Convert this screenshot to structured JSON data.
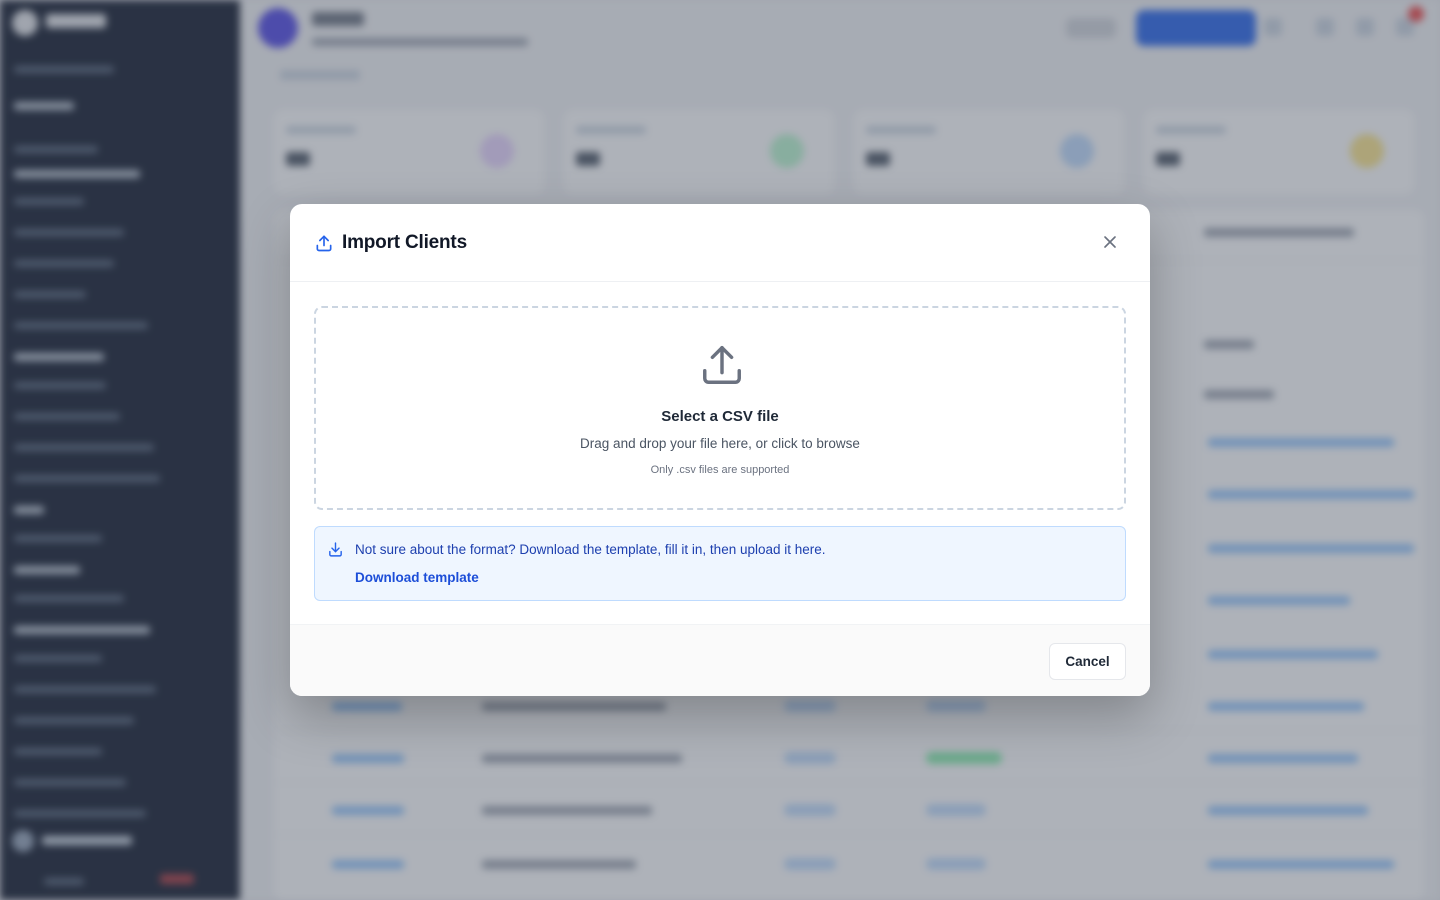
{
  "modal": {
    "title": "Import Clients",
    "close_icon": "close-icon",
    "header_icon": "upload-icon",
    "dropzone": {
      "icon": "upload-icon",
      "title": "Select a CSV file",
      "subtitle": "Drag and drop your file here, or click to browse",
      "note": "Only .csv files are supported"
    },
    "info": {
      "icon": "download-icon",
      "message": "Not sure about the format? Download the template, fill it in, then upload it here.",
      "link_label": "Download template"
    },
    "footer": {
      "cancel_label": "Cancel"
    }
  },
  "colors": {
    "primary": "#2563eb",
    "info_background": "#eff6ff",
    "info_text": "#1e40af",
    "sidebar": "#0f172a",
    "overlay": "rgba(75,85,99,0.45)"
  }
}
